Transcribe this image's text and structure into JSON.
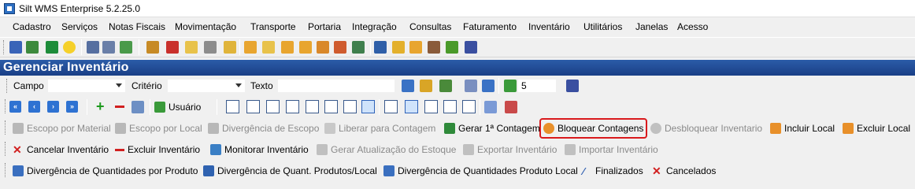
{
  "window": {
    "title": "Silt WMS Enterprise 5.2.25.0"
  },
  "menu": [
    "Cadastro",
    "Serviços",
    "Notas Fiscais",
    "Movimentação",
    "Transporte",
    "Portaria",
    "Integração",
    "Consultas",
    "Faturamento",
    "Inventário",
    "Utilitários",
    "Janelas",
    "Acesso"
  ],
  "page": {
    "title": "Gerenciar Inventário"
  },
  "filter": {
    "campo_label": "Campo",
    "criterio_label": "Critério",
    "texto_label": "Texto",
    "count_value": "5"
  },
  "view_toolbar": {
    "usuario_label": "Usuário"
  },
  "actions_row1": [
    {
      "label": "Escopo por Material",
      "enabled": false
    },
    {
      "label": "Escopo por Local",
      "enabled": false
    },
    {
      "label": "Divergência de Escopo",
      "enabled": false
    },
    {
      "label": "Liberar para Contagem",
      "enabled": false
    },
    {
      "label": "Gerar 1ª Contagem",
      "enabled": true
    },
    {
      "label": "Bloquear Contagens",
      "enabled": true,
      "highlighted": true
    },
    {
      "label": "Desbloquear Inventario",
      "enabled": false
    },
    {
      "label": "Incluir Local",
      "enabled": true
    },
    {
      "label": "Excluir Local",
      "enabled": true
    }
  ],
  "actions_row2": [
    {
      "label": "Cancelar Inventário",
      "enabled": true
    },
    {
      "label": "Excluir Inventário",
      "enabled": true
    },
    {
      "label": "Monitorar Inventário",
      "enabled": true
    },
    {
      "label": "Gerar Atualização do Estoque",
      "enabled": false
    },
    {
      "label": "Exportar Inventário",
      "enabled": false
    },
    {
      "label": "Importar Inventário",
      "enabled": false
    }
  ],
  "actions_row3": [
    {
      "label": "Divergência de Quantidades por Produto",
      "enabled": true
    },
    {
      "label": "Divergência de Quant. Produtos/Local",
      "enabled": true
    },
    {
      "label": "Divergência de Quantidades Produto Local",
      "enabled": true
    },
    {
      "label": "Finalizados",
      "enabled": true
    },
    {
      "label": "Cancelados",
      "enabled": true
    }
  ],
  "colors": {
    "header_bg": "#1f4a94",
    "highlight": "#d9191c"
  }
}
